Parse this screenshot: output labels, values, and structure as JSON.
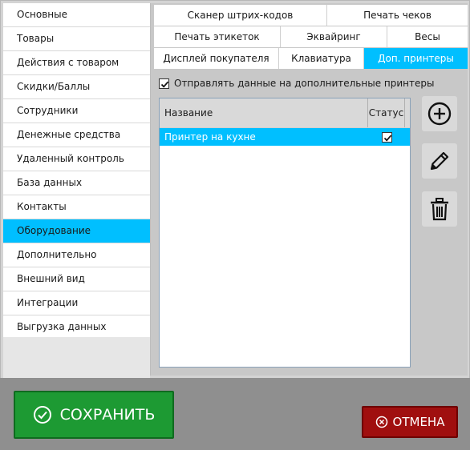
{
  "sidebar": {
    "items": [
      {
        "label": "Основные"
      },
      {
        "label": "Товары"
      },
      {
        "label": "Действия с товаром"
      },
      {
        "label": "Скидки/Баллы"
      },
      {
        "label": "Сотрудники"
      },
      {
        "label": "Денежные средства"
      },
      {
        "label": "Удаленный контроль"
      },
      {
        "label": "База данных"
      },
      {
        "label": "Контакты"
      },
      {
        "label": "Оборудование"
      },
      {
        "label": "Дополнительно"
      },
      {
        "label": "Внешний вид"
      },
      {
        "label": "Интеграции"
      },
      {
        "label": "Выгрузка данных"
      }
    ],
    "active_index": 9
  },
  "tabs": {
    "row1": [
      "Сканер штрих-кодов",
      "Печать чеков"
    ],
    "row2": [
      "Печать этикеток",
      "Эквайринг",
      "Весы"
    ],
    "row3": [
      "Дисплей покупателя",
      "Клавиатура",
      "Доп. принтеры"
    ],
    "active": "Доп. принтеры"
  },
  "printers": {
    "send_checkbox_label": "Отправлять данные на дополнительные принтеры",
    "send_checkbox_checked": true,
    "columns": [
      "Название",
      "Статус"
    ],
    "rows": [
      {
        "name": "Принтер на кухне",
        "status": true
      }
    ]
  },
  "actions": {
    "add_icon": "plus-circle-icon",
    "edit_icon": "pencil-icon",
    "delete_icon": "trash-icon"
  },
  "footer": {
    "save_label": "СОХРАНИТЬ",
    "cancel_label": "ОТМЕНА"
  },
  "colors": {
    "accent": "#00bfff",
    "save": "#1d9a33",
    "cancel": "#a00f0f"
  }
}
